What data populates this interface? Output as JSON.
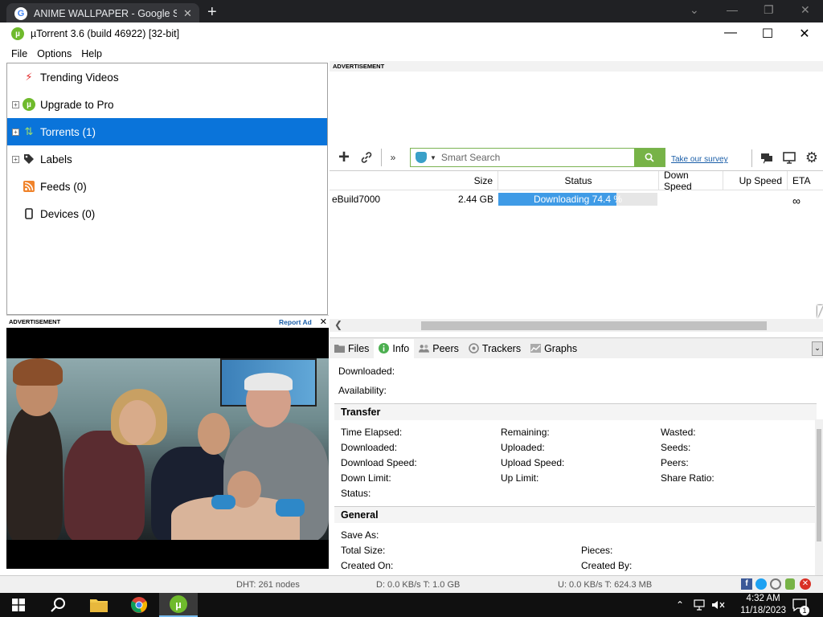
{
  "browser": {
    "tab_title": "ANIME WALLPAPER - Google Sea",
    "tab_favicon": "G",
    "new_tab": "+",
    "close_tab": "✕"
  },
  "window": {
    "title": "µTorrent 3.6  (build 46922) [32-bit]",
    "app_icon": "µ",
    "minimize": "—",
    "maximize": "☐",
    "close": "✕"
  },
  "menu": [
    "File",
    "Options",
    "Help"
  ],
  "sidebar": {
    "items": [
      {
        "label": "Trending Videos",
        "icon": "lightning-icon",
        "glyph": "⚡",
        "color": "#e32626"
      },
      {
        "label": "Upgrade to Pro",
        "icon": "utorrent-logo-icon",
        "glyph": "µ",
        "color": "#6fba2c"
      },
      {
        "label": "Torrents (1)",
        "icon": "torrents-icon",
        "glyph": "⇅",
        "color": "#39a0d0"
      },
      {
        "label": "Labels",
        "icon": "tag-icon",
        "glyph": "🏷",
        "color": "#333333"
      },
      {
        "label": "Feeds (0)",
        "icon": "rss-icon",
        "glyph": "◙",
        "color": "#f0832b"
      },
      {
        "label": "Devices (0)",
        "icon": "device-icon",
        "glyph": "▯",
        "color": "#333333"
      }
    ],
    "selected_index": 2
  },
  "left_ad": {
    "label": "ADVERTISEMENT",
    "report": "Report Ad",
    "close": "✕"
  },
  "right_ad": {
    "label": "ADVERTISEMENT"
  },
  "toolbar": {
    "add": "+",
    "link": "🔗",
    "more": "»",
    "search_placeholder": "Smart Search",
    "search_go": "🔍",
    "survey": "Take our survey",
    "chat": "💬",
    "monitor": "🖥",
    "settings": "⚙"
  },
  "torrent_list": {
    "columns": [
      "Size",
      "Status",
      "Down Speed",
      "Up Speed",
      "ETA"
    ],
    "rows": [
      {
        "name": "eBuild7000",
        "size": "2.44 GB",
        "status": "Downloading 74.4 %",
        "progress": 74.4,
        "down_speed": "",
        "up_speed": "",
        "eta": "∞"
      }
    ]
  },
  "tabs": [
    {
      "label": "Files",
      "icon": "folder-icon"
    },
    {
      "label": "Info",
      "icon": "info-icon"
    },
    {
      "label": "Peers",
      "icon": "peers-icon"
    },
    {
      "label": "Trackers",
      "icon": "trackers-icon"
    },
    {
      "label": "Graphs",
      "icon": "graph-icon"
    }
  ],
  "info": {
    "downloaded": "Downloaded:",
    "availability": "Availability:",
    "transfer": {
      "title": "Transfer",
      "col1": [
        "Time Elapsed:",
        "Downloaded:",
        "Download Speed:",
        "Down Limit:",
        "Status:"
      ],
      "col2": [
        "Remaining:",
        "Uploaded:",
        "Upload Speed:",
        "Up Limit:"
      ],
      "col3": [
        "Wasted:",
        "Seeds:",
        "Peers:",
        "Share Ratio:"
      ]
    },
    "general": {
      "title": "General",
      "save_as": "Save As:",
      "total_size": "Total Size:",
      "created_on": "Created On:",
      "pieces": "Pieces:",
      "created_by": "Created By:"
    }
  },
  "status": {
    "dht": "DHT: 261 nodes",
    "down": "D: 0.0 KB/s T: 1.0 GB",
    "up": "U: 0.0 KB/s T: 624.3 MB"
  },
  "taskbar": {
    "time": "4:32 AM",
    "date": "11/18/2023",
    "notif_count": "1"
  }
}
